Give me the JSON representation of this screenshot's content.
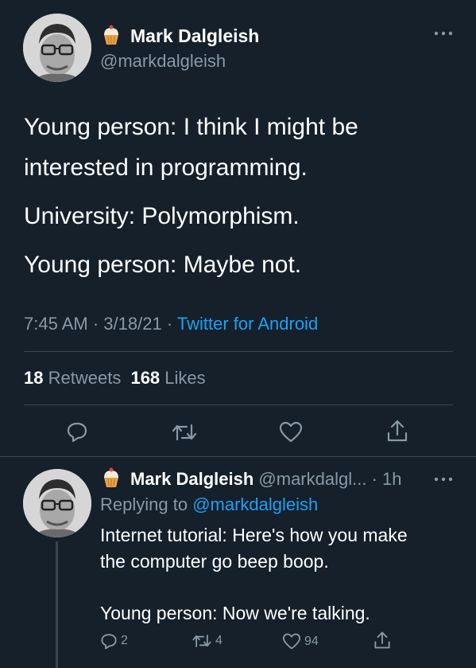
{
  "main_tweet": {
    "author_name": "Mark Dalgleish",
    "author_handle": "@markdalgleish",
    "emoji_icon": "cupcake-icon",
    "lines": [
      "Young person: I think I might be",
      "interested in programming.",
      "University: Polymorphism.",
      "Young person: Maybe not."
    ],
    "time": "7:45 AM",
    "sep1": "·",
    "date": "3/18/21",
    "sep2": "·",
    "source": "Twitter for Android",
    "retweets_count": "18",
    "retweets_label": "Retweets",
    "likes_count": "168",
    "likes_label": "Likes",
    "more_icon": "ellipsis-icon"
  },
  "actions": {
    "reply_icon": "reply-icon",
    "retweet_icon": "retweet-icon",
    "like_icon": "heart-icon",
    "share_icon": "share-icon"
  },
  "reply_tweet": {
    "author_name": "Mark Dalgleish",
    "author_handle": "@markdalgl...",
    "time_ago": "· 1h",
    "replying_prefix": "Replying to",
    "replying_handle": "@markdalgleish",
    "body_line1": "Internet tutorial: Here's how you make",
    "body_line2": "the computer go beep boop.",
    "body_line3": "Young person: Now we're talking.",
    "reply_count": "2",
    "retweet_count": "4",
    "like_count": "94"
  },
  "colors": {
    "background": "#15202b",
    "text": "#ffffff",
    "muted": "#8899a6",
    "accent": "#1da1f2",
    "divider": "#38444d"
  }
}
